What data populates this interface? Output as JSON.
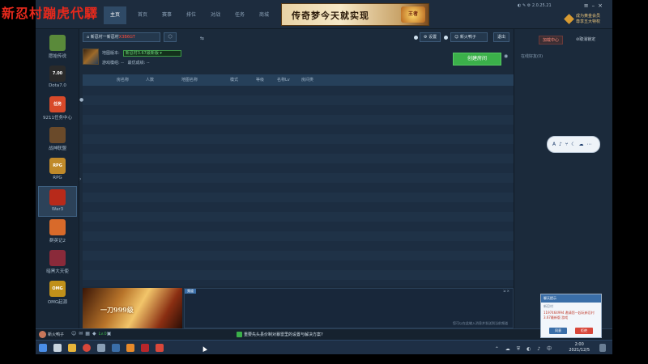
{
  "overlay_title": "新忍村蹦虎代驛",
  "top_nav": {
    "tabs": [
      "主页",
      "首页",
      "赛事",
      "排位",
      "对战",
      "任务",
      "商城"
    ],
    "active_index": 0
  },
  "banner": {
    "text": "传奇梦今天就实现",
    "logo": "王者"
  },
  "version": "2.0.25.21",
  "vip": {
    "line1": "成为黄金会员",
    "line2": "尊享五大特权"
  },
  "sidebar": {
    "items": [
      {
        "label": "愿始传说",
        "icon_text": "",
        "color": "#5a8a3a"
      },
      {
        "label": "Dota7.0",
        "icon_text": "7.00",
        "color": "#2a2a2a"
      },
      {
        "label": "9211任务中心",
        "icon_text": "任务",
        "color": "#d84a2a"
      },
      {
        "label": "战神联盟",
        "icon_text": "",
        "color": "#6a4a2a"
      },
      {
        "label": "RPG",
        "icon_text": "RPG",
        "color": "#c08a2a"
      },
      {
        "label": "War3",
        "icon_text": "",
        "color": "#b82a1a"
      },
      {
        "label": "群英记2",
        "icon_text": "",
        "color": "#d86a2a"
      },
      {
        "label": "暗黑大天使",
        "icon_text": "",
        "color": "#8a2a3a"
      },
      {
        "label": "OMG起源",
        "icon_text": "OMG",
        "color": "#c0901a"
      }
    ],
    "active_index": 5
  },
  "room": {
    "tab_prefix": "新忍村一新忍村",
    "tab_red": "X3B6GT",
    "tool_icon": "⇆",
    "user_label": "新火鸭子",
    "settings_label": "设置",
    "exit_label": "退出"
  },
  "map": {
    "label": "地图版本:",
    "value": "新忍村3.67最新版",
    "stat_label": "游戏模组:",
    "stat_value": "--",
    "stat2_label": "最优成绩:",
    "stat2_value": "--"
  },
  "create_button": "创建房间",
  "table": {
    "columns": [
      "房名称",
      "人数",
      "地图名称",
      "模式",
      "等级",
      "名称Lv",
      "房间类"
    ]
  },
  "right_panel": {
    "tab_active": "加载中心",
    "tab_other": "⊘取消锁定",
    "note": "在线好友(0)"
  },
  "promo": {
    "text": "一刀999级"
  },
  "chat": {
    "tab": "频道",
    "controls": "⇲ ×",
    "footer": "您可以在此输入消息并发送到当前频道"
  },
  "status_bar": {
    "user": "新火鸭子",
    "level": "Lv.0",
    "tip": "重要先头县价制对暴雷里的设置与解决方案?"
  },
  "floating_bar": {
    "text": "A ♪ ⑂ ☾ ☁ ⋯"
  },
  "notification": {
    "title": "聊天提示",
    "subtitle": "新忍村",
    "body": "1197464994 邀请您一起玩新忍村3.67最新版 游戏",
    "accept": "同意",
    "reject": "拒绝"
  },
  "taskbar": {
    "time": "2:00",
    "date": "2021/12/5"
  },
  "colors": {
    "app_bg": "#1b2a3b",
    "accent_green": "#3bb04a",
    "alert_red": "#ff4a3a",
    "overlay_red": "#e8291c"
  }
}
